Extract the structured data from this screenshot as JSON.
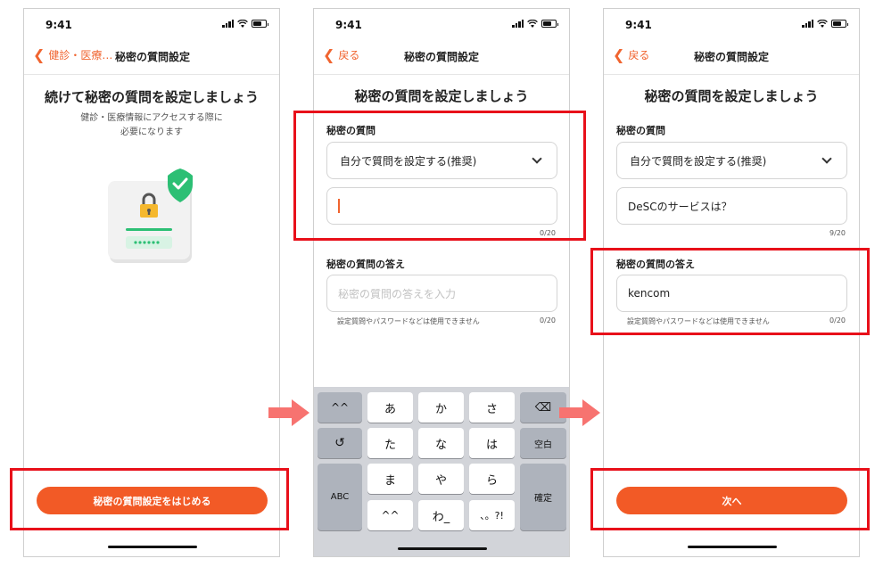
{
  "status": {
    "time": "9:41"
  },
  "screen1": {
    "back_label": "健診・医療…",
    "nav_title": "秘密の質問設定",
    "heading": "続けて秘密の質問を設定しましょう",
    "subtext": "健診・医療情報にアクセスする際に\n必要になります",
    "cta": "秘密の質問設定をはじめる"
  },
  "screen2": {
    "back_label": "戻る",
    "nav_title": "秘密の質問設定",
    "heading": "秘密の質問を設定しましょう",
    "question_label": "秘密の質問",
    "question_select": "自分で質問を設定する(推奨)",
    "question_input_value": "",
    "question_count": "0/20",
    "answer_label": "秘密の質問の答え",
    "answer_placeholder": "秘密の質問の答えを入力",
    "answer_note": "設定質問やパスワードなどは使用できません",
    "answer_count": "0/20",
    "keyboard": {
      "emoticon_key": "^^",
      "undo_key": "↺",
      "abc_key": "ABC",
      "delete_key": "⌫",
      "space_key": "空白",
      "confirm_key": "確定",
      "row1": [
        "あ",
        "か",
        "さ"
      ],
      "row2": [
        "た",
        "な",
        "は"
      ],
      "row3": [
        "ま",
        "や",
        "ら"
      ],
      "row4": [
        "^^",
        "わ_",
        "、。?!"
      ]
    }
  },
  "screen3": {
    "back_label": "戻る",
    "nav_title": "秘密の質問設定",
    "heading": "秘密の質問を設定しましょう",
    "question_label": "秘密の質問",
    "question_select": "自分で質問を設定する(推奨)",
    "question_input_value": "DeSCのサービスは？",
    "question_count": "9/20",
    "answer_label": "秘密の質問の答え",
    "answer_input_value": "kencom",
    "answer_note": "設定質問やパスワードなどは使用できません",
    "answer_count": "0/20",
    "cta": "次へ"
  },
  "colors": {
    "accent": "#f25a26",
    "highlight_box": "#e8101a",
    "flow_arrow": "#f77370",
    "shield": "#2cbf74"
  },
  "icons": {
    "back": "chevron-left-icon",
    "dropdown": "chevron-down-icon",
    "illustration": "lock-password-shield-icon"
  }
}
